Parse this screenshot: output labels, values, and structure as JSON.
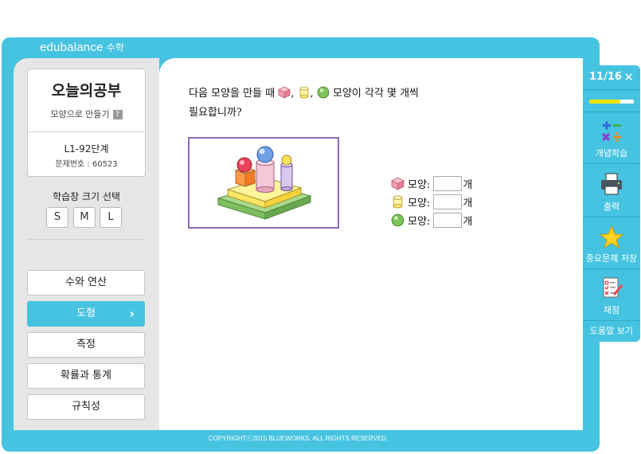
{
  "app": {
    "brand": "edubalance",
    "brand_sub": "수학"
  },
  "lesson_card": {
    "title": "오늘의공부",
    "subtitle": "모양으로 만들기",
    "help": "?",
    "level": "L1-92단계",
    "problem_number": "문제번호 : 60523"
  },
  "window_size": {
    "label": "학습창 크기 선택",
    "options": [
      "S",
      "M",
      "L"
    ]
  },
  "menu": {
    "items": [
      {
        "label": "수와 연산",
        "active": false
      },
      {
        "label": "도형",
        "active": true,
        "arrow": "›"
      },
      {
        "label": "측정",
        "active": false
      },
      {
        "label": "확률과 통계",
        "active": false
      },
      {
        "label": "규칙성",
        "active": false
      }
    ]
  },
  "question": {
    "line1_part1": "다음 모양을 만들 때",
    "line1_part2": "모양이 각각 몇 개씩",
    "line2": "필요합니까?",
    "sep": ","
  },
  "answers": [
    {
      "shape": "cube",
      "label": "모양:",
      "value": "",
      "unit": "개"
    },
    {
      "shape": "cylinder",
      "label": "모양:",
      "value": "",
      "unit": "개"
    },
    {
      "shape": "sphere",
      "label": "모양:",
      "value": "",
      "unit": "개"
    }
  ],
  "toolbar": {
    "counter": "11/16",
    "close": "✕",
    "progress": 0.6875,
    "concept": "개념학습",
    "print": "출력",
    "save": "중요문제 저장",
    "grade": "채점",
    "help": "도움말 보기"
  },
  "footer": {
    "copyright": "COPYRIGHTⓒ2015 BLUEWORKS. ALL RIGHTS RESERVED."
  },
  "colors": {
    "accent": "#45c3e1",
    "progress": "#ffe100",
    "frame_border": "#8a6bb8"
  }
}
